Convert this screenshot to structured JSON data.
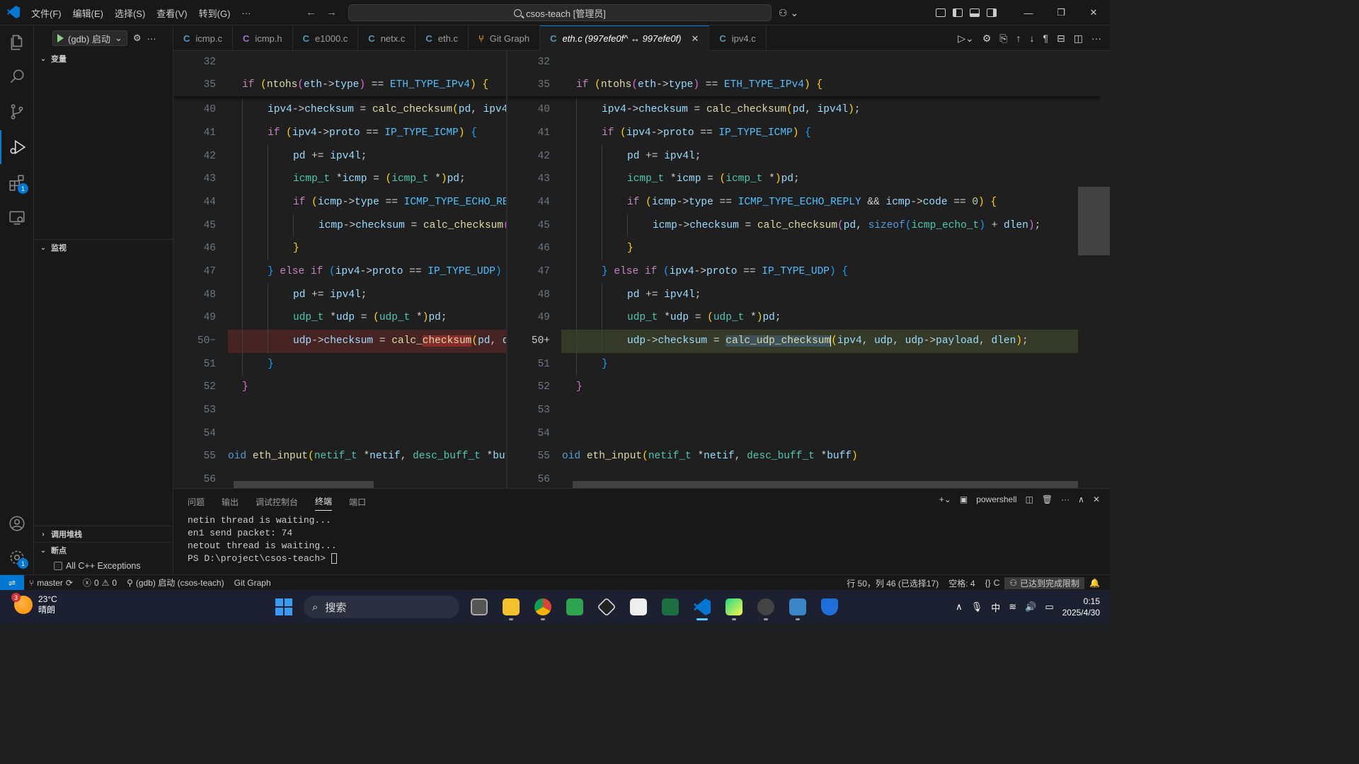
{
  "menu": [
    "文件(F)",
    "编辑(E)",
    "选择(S)",
    "查看(V)",
    "转到(G)",
    "···"
  ],
  "command_center": "csos-teach [管理员]",
  "sidebar": {
    "run_label": "(gdb) 启动",
    "variables": "变量",
    "watch": "监视",
    "callstack": "调用堆栈",
    "breakpoints": "断点",
    "bp_item": "All C++ Exceptions"
  },
  "tabs": [
    {
      "label": "icmp.c",
      "icon": "C"
    },
    {
      "label": "icmp.h",
      "icon": "C"
    },
    {
      "label": "e1000.c",
      "icon": "C"
    },
    {
      "label": "netx.c",
      "icon": "C"
    },
    {
      "label": "eth.c",
      "icon": "C"
    },
    {
      "label": "Git Graph",
      "icon": "git-graph"
    },
    {
      "label": "eth.c (997efe0f^ ↔ 997efe0f)",
      "icon": "C",
      "active": true
    },
    {
      "label": "ipv4.c",
      "icon": "C"
    }
  ],
  "diff": {
    "line_numbers": [
      "32",
      "35",
      "40",
      "41",
      "42",
      "43",
      "44",
      "45",
      "46",
      "47",
      "48",
      "49",
      "50",
      "51",
      "52",
      "53",
      "54",
      "55",
      "56"
    ],
    "changed_left_marker": "50−",
    "changed_right_marker": "50+"
  },
  "panel": {
    "tabs": [
      "问题",
      "输出",
      "调试控制台",
      "终端",
      "端口"
    ],
    "active": "终端",
    "shell": "powershell",
    "lines": [
      "netin thread is waiting...",
      "en1 send packet: 74",
      "netout thread is waiting...",
      "PS D:\\project\\csos-teach>"
    ]
  },
  "status": {
    "branch": "master",
    "errors": "0",
    "warnings": "0",
    "debug": "(gdb) 启动 (csos-teach)",
    "gitgraph": "Git Graph",
    "position": "行 50，列 46 (已选择17)",
    "spaces": "空格: 4",
    "lang": "C",
    "limit": "已达到完成限制"
  },
  "taskbar": {
    "temp": "23°C",
    "weather": "晴朗",
    "weather_badge": "3",
    "search": "搜索",
    "ime": "中",
    "time": "0:15",
    "date": "2025/4/30"
  },
  "colors": {
    "accent": "#0078d4",
    "deleted": "#5a1d1d",
    "inserted": "#373d29"
  }
}
